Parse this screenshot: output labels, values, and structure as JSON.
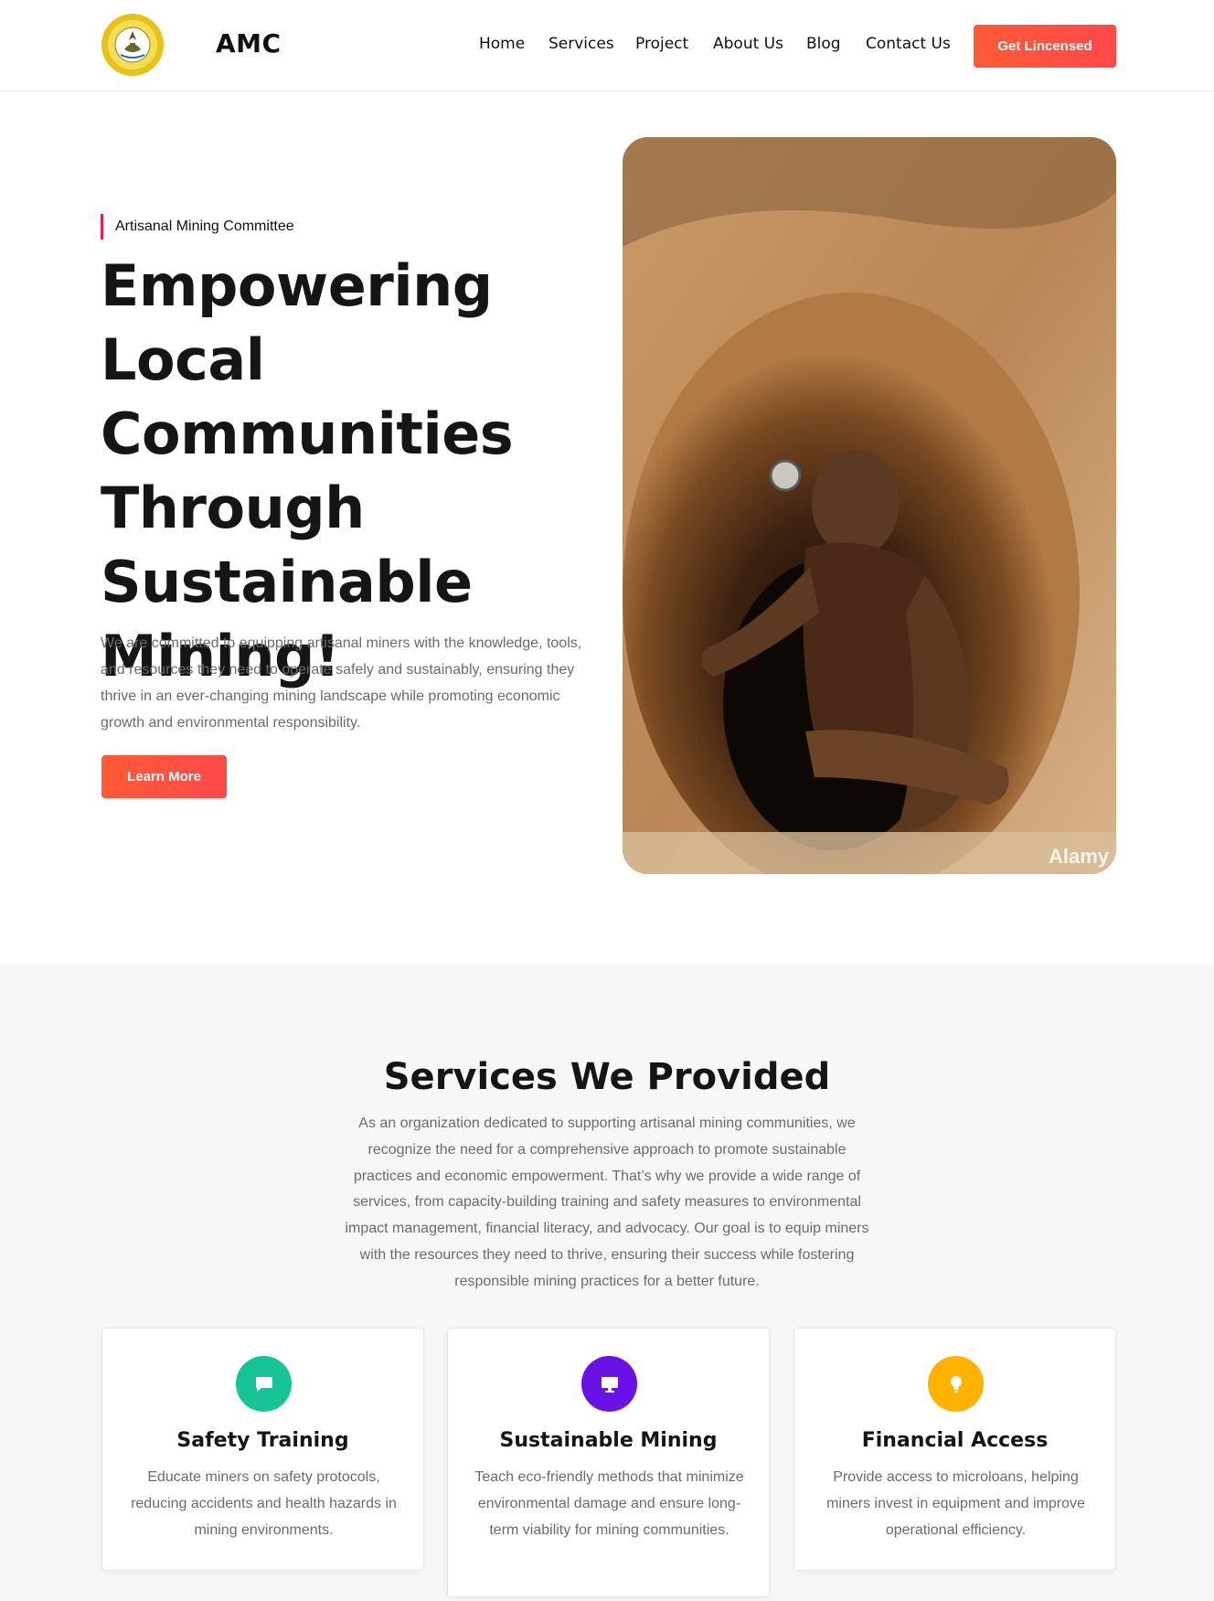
{
  "header": {
    "brand": "AMC",
    "nav": [
      "Home",
      "Services",
      "Project",
      "About Us",
      "Blog",
      "Contact Us"
    ],
    "cta_label": "Get Lincensed"
  },
  "hero": {
    "tag": "Artisanal Mining Committee",
    "title_lines": [
      "Empowering Local",
      "Communities",
      "Through",
      "Sustainable",
      "Mining!"
    ],
    "description": "We are committed to equipping artisanal miners with the knowledge, tools, and resources they need to operate safely and sustainably, ensuring they thrive in an ever-changing mining landscape while promoting economic growth and environmental responsibility.",
    "button_label": "Learn More",
    "image_watermark": "Alamy"
  },
  "services": {
    "title": "Services We Provided",
    "description": "As an organization dedicated to supporting artisanal mining communities, we recognize the need for a comprehensive approach to promote sustainable practices and economic empowerment. That’s why we provide a wide range of services, from capacity-building training and safety measures to environmental impact management, financial literacy, and advocacy. Our goal is to equip miners with the resources they need to thrive, ensuring their success while fostering responsible mining practices for a better future.",
    "cards": [
      {
        "title": "Safety Training",
        "text": "Educate miners on safety protocols, reducing accidents and health hazards in mining environments.",
        "icon": "chat-bubble-icon",
        "color": "#17c495"
      },
      {
        "title": "Sustainable Mining",
        "text": "Teach eco-friendly methods that minimize environmental damage and ensure long-term viability for mining communities.",
        "icon": "monitor-icon",
        "color": "#6a11e6"
      },
      {
        "title": "Financial Access",
        "text": "Provide access to microloans, helping miners invest in equipment and improve operational efficiency.",
        "icon": "lightbulb-icon",
        "color": "#ffb300"
      }
    ]
  }
}
